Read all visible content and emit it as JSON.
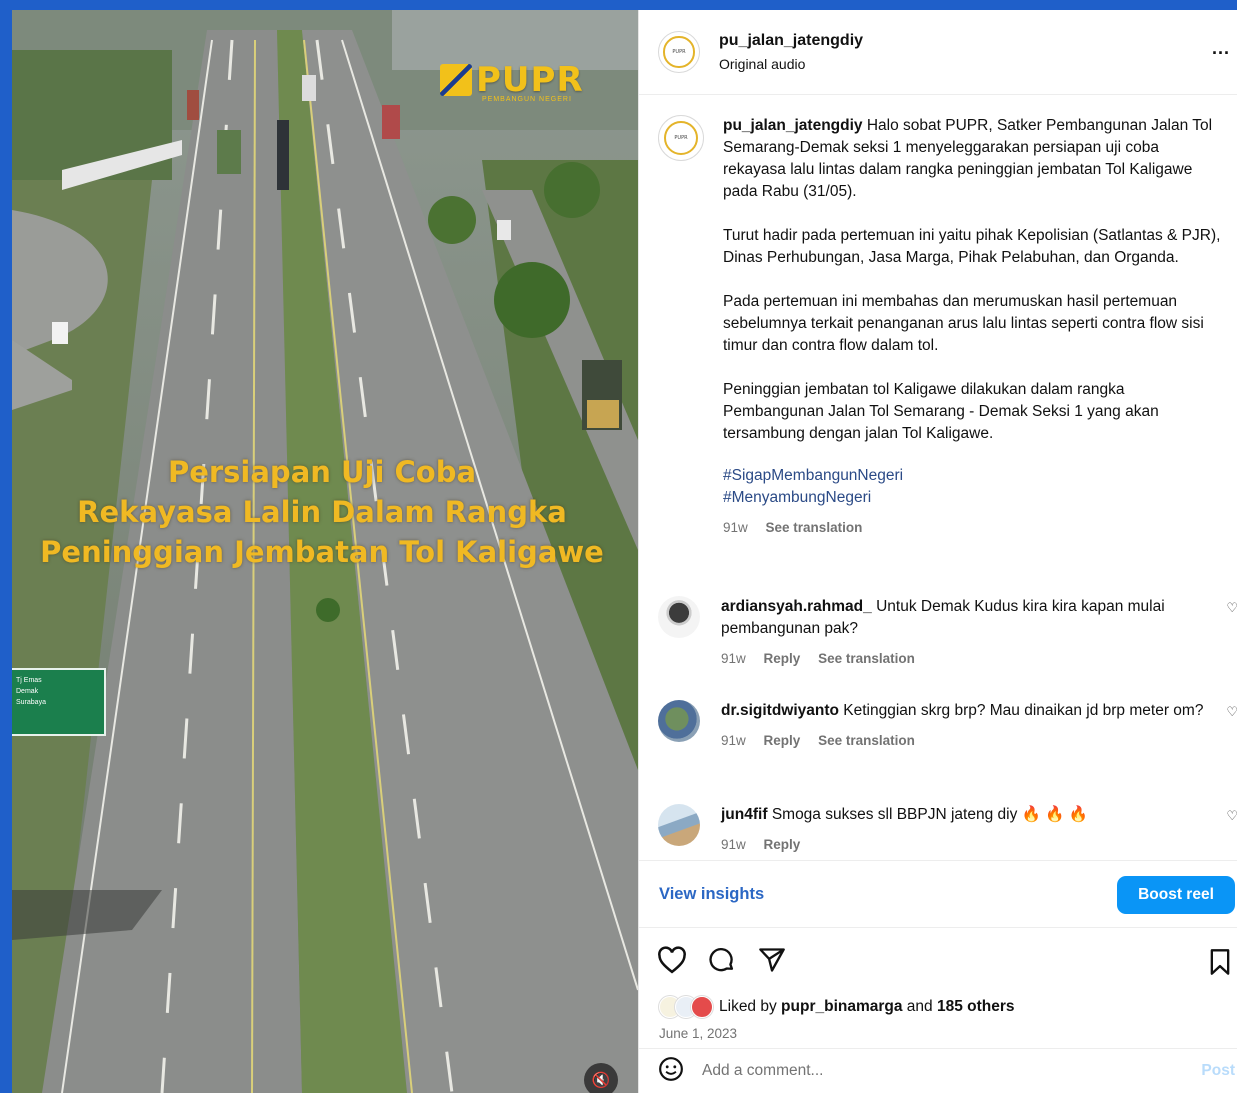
{
  "video": {
    "brand": "PUPR",
    "brand_sub": "PEMBANGUN NEGERI",
    "overlay_lines": [
      "Persiapan Uji Coba",
      "Rekayasa Lalin  Dalam Rangka",
      "Peninggian Jembatan Tol Kaligawe"
    ],
    "sign_lines": [
      "Tj Emas",
      "Demak",
      "Surabaya"
    ],
    "mute_icon": "speaker-muted-icon"
  },
  "header": {
    "username": "pu_jalan_jatengdiy",
    "audio": "Original audio",
    "more": "..."
  },
  "caption": {
    "username": "pu_jalan_jatengdiy",
    "paragraphs": [
      "Halo sobat PUPR, Satker Pembangunan Jalan Tol Semarang-Demak seksi 1 menyeleggarakan persiapan uji coba rekayasa lalu lintas dalam rangka peninggian jembatan Tol Kaligawe pada Rabu (31/05).",
      "Turut hadir pada pertemuan ini yaitu pihak Kepolisian (Satlantas & PJR), Dinas Perhubungan, Jasa Marga, Pihak Pelabuhan, dan Organda.",
      "Pada pertemuan ini membahas dan merumuskan hasil pertemuan sebelumnya terkait penanganan arus lalu lintas seperti contra flow sisi timur dan contra flow dalam tol.",
      "Peninggian jembatan tol Kaligawe dilakukan dalam rangka Pembangunan Jalan Tol Semarang - Demak Seksi 1 yang akan tersambung dengan jalan Tol Kaligawe."
    ],
    "hashtags": [
      "#SigapMembangunNegeri",
      "#MenyambungNegeri"
    ],
    "age": "91w",
    "see_translation": "See translation"
  },
  "comments": [
    {
      "username": "ardiansyah.rahmad_",
      "text": "Untuk Demak Kudus kira kira kapan mulai pembangunan pak?",
      "age": "91w",
      "reply": "Reply",
      "see_translation": "See translation"
    },
    {
      "username": "dr.sigitdwiyanto",
      "text": "Ketinggian skrg brp? Mau dinaikan jd brp meter om?",
      "age": "91w",
      "reply": "Reply",
      "see_translation": "See translation"
    },
    {
      "username": "jun4fif",
      "text": "Smoga sukses sll BBPJN jateng diy 🔥 🔥 🔥",
      "age": "91w",
      "reply": "Reply"
    }
  ],
  "insights": {
    "view_label": "View insights",
    "boost_label": "Boost reel"
  },
  "likes": {
    "prefix": "Liked by ",
    "user": "pupr_binamarga",
    "middle": " and ",
    "others": "185 others",
    "date": "June 1, 2023"
  },
  "add_comment": {
    "placeholder": "Add a comment...",
    "post_label": "Post"
  },
  "colors": {
    "page_background": "#1f5fc9",
    "link_blue": "#2b67c4",
    "boost_blue": "#0a95f6",
    "overlay_yellow": "#f0b923"
  }
}
